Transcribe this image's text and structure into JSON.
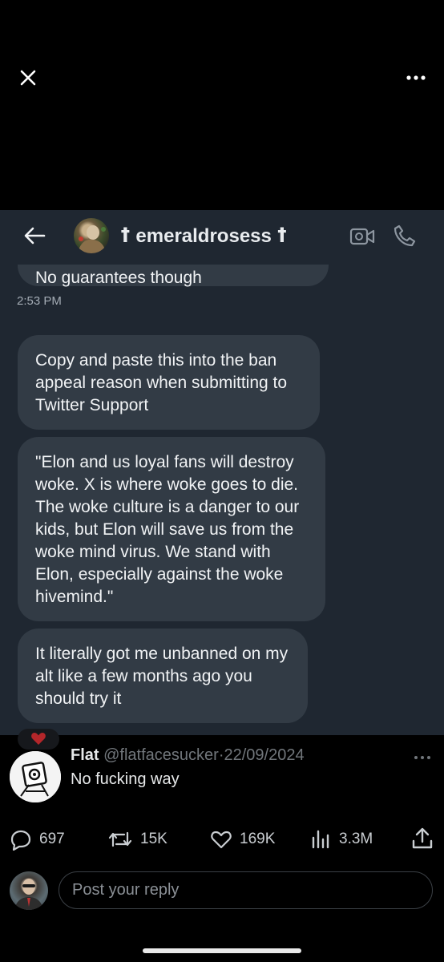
{
  "viewer": {
    "close_icon": "close-icon",
    "more_icon": "more-horizontal-icon"
  },
  "screenshot": {
    "header": {
      "contact_name": "ꝉ emeraldrosess ꝉ",
      "back_icon": "arrow-left-icon",
      "video_icon": "video-call-icon",
      "phone_icon": "phone-icon"
    },
    "cut_message": "No guarantees though",
    "timestamp": "2:53 PM",
    "messages": [
      "Copy and paste this into the ban appeal reason when submitting to Twitter Support",
      "\"Elon and us loyal fans will destroy woke. X is where woke goes to die. The woke culture is a danger to our kids, but Elon will save us from the woke mind virus. We stand with Elon, especially against the woke hivemind.\"",
      "It literally got me unbanned on my alt like a few months ago you should try it"
    ],
    "reaction_icon": "heart-icon",
    "colors": {
      "chat_bg": "#1f2731",
      "bubble": "#323b45"
    }
  },
  "post": {
    "author_name": "Flat",
    "handle": "@flatfacesucker",
    "separator": "·",
    "date": "22/09/2024",
    "text": "No fucking way",
    "more_icon": "more-horizontal-icon"
  },
  "actions": {
    "replies": "697",
    "reposts": "15K",
    "likes": "169K",
    "views": "3.3M",
    "share_icon": "share-icon"
  },
  "reply": {
    "placeholder": "Post your reply"
  }
}
